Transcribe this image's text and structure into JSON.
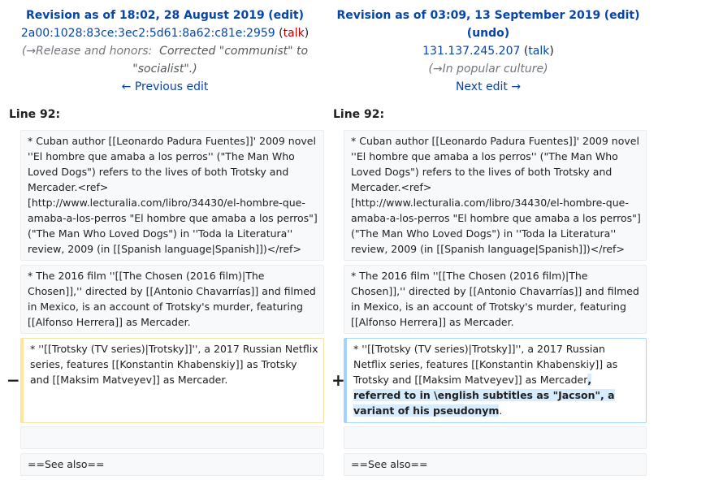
{
  "left": {
    "title_prefix": "Revision as of 18:02, 28 August 2019",
    "edit_label": "edit",
    "user": "2a00:1028:83ce:3ec2:5d61:8a62:c81e:2959",
    "talk_label": "talk",
    "summary_section": "(→Release and honors:",
    "summary_text": "Corrected \"communist\" to \"socialist\".)",
    "nav_label": "← Previous edit",
    "line_label": "Line 92:"
  },
  "right": {
    "title_prefix": "Revision as of 03:09, 13 September 2019",
    "edit_label": "edit",
    "undo_label": "undo",
    "user": "131.137.245.207",
    "talk_label": "talk",
    "summary_section": "(→In popular culture)",
    "nav_label": "Next edit →",
    "line_label": "Line 92:"
  },
  "diff": {
    "ctx1": "* Cuban author [[Leonardo Padura Fuentes]]' 2009 novel ''El hombre que amaba a los perros'' (\"The Man Who Loved Dogs\") refers to the lives of both Trotsky and Mercader.<ref>[http://www.lecturalia.com/libro/34430/el-hombre-que-amaba-a-los-perros \"El hombre que amaba a los perros\"] (\"The Man Who Loved Dogs\") in ''Toda la Literatura'' review, 2009 (in [[Spanish language|Spanish]])</ref>",
    "ctx2": "* The 2016 film ''[[The Chosen (2016 film)|The Chosen]],'' directed by [[Antonio Chavarrías]] and filmed in Mexico, is an account of Trotsky's murder, featuring [[Alfonso Herrera]] as Mercader.",
    "del_text": "* ''[[Trotsky (TV series)|Trotsky]]'', a 2017 Russian Netflix series, features [[Konstantin Khabenskiy]] as Trotsky and [[Maksim Matveyev]] as Mercader.",
    "add_text": "* ''[[Trotsky (TV series)|Trotsky]]'', a 2017 Russian Netflix series, features [[Konstantin Khabenskiy]] as Trotsky and [[Maksim Matveyev]] as Mercader",
    "add_highlight": ", referred to in \\english subtitles as \"Jacson\", a variant of his pseudonym",
    "add_tail": ".",
    "ctx4": "==See also==",
    "minus": "−",
    "plus": "+"
  }
}
